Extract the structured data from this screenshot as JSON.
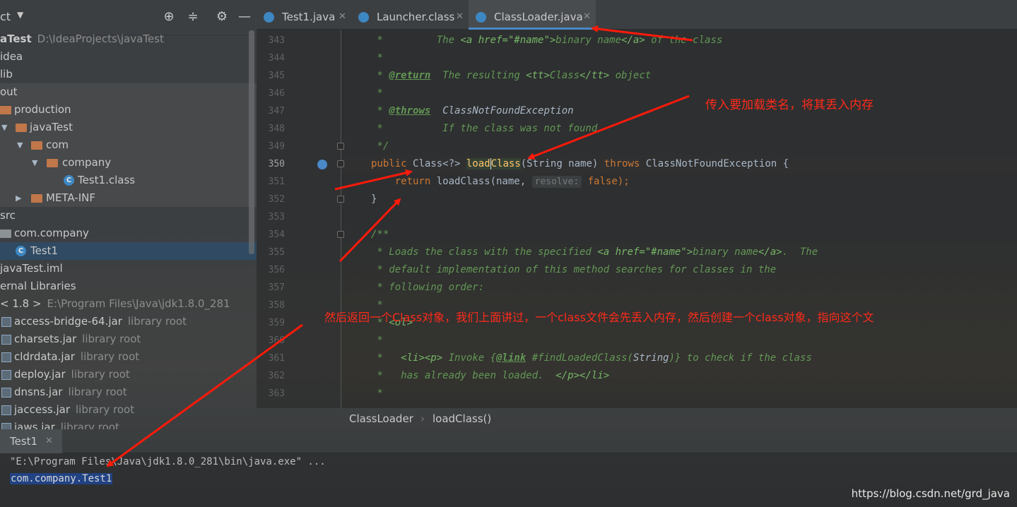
{
  "project": {
    "title": "ct",
    "tree": [
      {
        "label": "aTest",
        "sub": "D:\\IdeaProjects\\javaTest"
      },
      {
        "label": "idea"
      },
      {
        "label": "lib"
      },
      {
        "label": "out"
      },
      {
        "label": "production"
      },
      {
        "label": "javaTest"
      },
      {
        "label": "com"
      },
      {
        "label": "company"
      },
      {
        "label": "Test1.class"
      },
      {
        "label": "META-INF"
      },
      {
        "label": "src"
      },
      {
        "label": "com.company"
      },
      {
        "label": "Test1"
      },
      {
        "label": "javaTest.iml"
      },
      {
        "label": "ernal Libraries"
      },
      {
        "label": "< 1.8 >",
        "sub": "E:\\Program Files\\Java\\jdk1.8.0_281"
      },
      {
        "label": "access-bridge-64.jar",
        "sub": "library root"
      },
      {
        "label": "charsets.jar",
        "sub": "library root"
      },
      {
        "label": "cldrdata.jar",
        "sub": "library root"
      },
      {
        "label": "deploy.jar",
        "sub": "library root"
      },
      {
        "label": "dnsns.jar",
        "sub": "library root"
      },
      {
        "label": "jaccess.jar",
        "sub": "library root"
      },
      {
        "label": "jaws.jar",
        "sub": "library root"
      }
    ]
  },
  "tabs": [
    {
      "label": "Test1.java"
    },
    {
      "label": "Launcher.class"
    },
    {
      "label": "ClassLoader.java"
    }
  ],
  "editor": {
    "lines": [
      "343",
      "344",
      "345",
      "346",
      "347",
      "348",
      "349",
      "350",
      "351",
      "352",
      "353",
      "354",
      "355",
      "356",
      "357",
      "358",
      "359",
      "360",
      "361",
      "362",
      "363"
    ],
    "code": {
      "l343a": " *         The ",
      "l343b": "<a href=\"#name\">",
      "l343c": "binary name",
      "l343d": "</a>",
      "l343e": " of the class",
      "l344": " *",
      "l345a": " * ",
      "l345b": "@return",
      "l345c": "  The resulting ",
      "l345d": "<tt>",
      "l345e": "Class",
      "l345f": "</tt>",
      "l345g": " object",
      "l346": " *",
      "l347a": " * ",
      "l347b": "@throws",
      "l347c": "  ClassNotFoundException",
      "l348": " *          If the class was not found",
      "l349": " */",
      "l350a": "public ",
      "l350b": "Class<?> ",
      "l350c": "load",
      "l350d": "Class",
      "l350e": "(String name) ",
      "l350f": "throws ",
      "l350g": "ClassNotFoundException {",
      "l351a": "    return ",
      "l351b": "loadClass(name, ",
      "l351c": "resolve:",
      "l351d": " false",
      "l351e": ");",
      "l352": "}",
      "l354": "/**",
      "l355a": " * Loads the class with the specified ",
      "l355b": "<a href=\"#name\">",
      "l355c": "binary name",
      "l355d": "</a>",
      "l355e": ".  The",
      "l356": " * default implementation of this method searches for classes in the",
      "l357": " * following order:",
      "l358": " *",
      "l359a": " * ",
      "l359b": "<ol>",
      "l360": " *",
      "l361a": " *   ",
      "l361b": "<li><p>",
      "l361c": " Invoke {",
      "l361d": "@link",
      "l361e": " #findLoadedClass(",
      "l361f": "String",
      "l361g": ")} to check if the class",
      "l362a": " *   has already been loaded.  ",
      "l362b": "</p></li>",
      "l363": " *"
    }
  },
  "annotations": {
    "a1": "传入要加载类名，将其丢入内存",
    "a2": "然后返回一个Class对象，我们上面讲过，一个class文件会先丢入内存，然后创建一个class对象，指向这个文"
  },
  "breadcrumb": {
    "class": "ClassLoader",
    "sep": "›",
    "method": "loadClass()"
  },
  "run": {
    "tab": "Test1",
    "line1": "\"E:\\Program Files\\Java\\jdk1.8.0_281\\bin\\java.exe\" ...",
    "line2": "com.company.Test1"
  },
  "watermark": "https://blog.csdn.net/grd_java",
  "colors": {
    "keyword": "#cc7832",
    "doc": "#629755",
    "method": "#ffc66d",
    "annotation": "#ff2a1a",
    "selection": "#214283"
  }
}
